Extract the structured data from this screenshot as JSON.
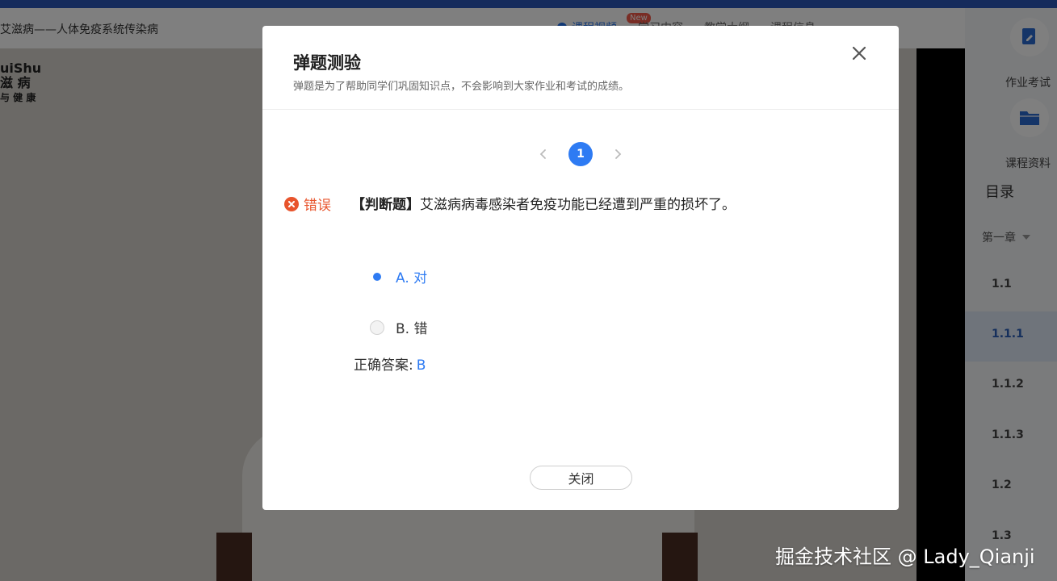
{
  "header": {
    "course_title": "艾滋病——人体免疫系统传染病",
    "tabs": [
      {
        "label": "课程视频",
        "active": true
      },
      {
        "label": "学习内容",
        "active": false
      },
      {
        "label": "教学大纲",
        "active": false
      },
      {
        "label": "课程信息",
        "active": false
      }
    ],
    "new_badge": "New"
  },
  "sidebar": {
    "tools": [
      {
        "label": "作业考试",
        "icon": "edit-document-icon"
      },
      {
        "label": "课程资料",
        "icon": "folder-icon"
      }
    ],
    "toc_title": "目录",
    "chapter": "第一章",
    "items": [
      {
        "label": "1.1",
        "active": false
      },
      {
        "label": "1.1.1",
        "active": true
      },
      {
        "label": "1.1.2",
        "active": false
      },
      {
        "label": "1.1.3",
        "active": false
      },
      {
        "label": "1.2",
        "active": false
      },
      {
        "label": "1.3",
        "active": false
      }
    ]
  },
  "video": {
    "logo_lines": [
      "uiShu",
      "滋 病",
      "与 健 康"
    ]
  },
  "modal": {
    "title": "弹题测验",
    "subtitle": "弹题是为了帮助同学们巩固知识点，不会影响到大家作业和考试的成绩。",
    "pager": {
      "current_page": "1"
    },
    "status_text": "错误",
    "question_type": "【判断题】",
    "question_text": "艾滋病病毒感染者免疫功能已经遭到严重的损坏了。",
    "options": [
      {
        "label": "A.  对",
        "selected": true
      },
      {
        "label": "B.  错",
        "selected": false
      }
    ],
    "answer_label": "正确答案:",
    "answer_value": "B",
    "close_button": "关闭"
  },
  "watermark": "掘金技术社区 @ Lady_Qianji",
  "colors": {
    "primary": "#2e7bf3",
    "error": "#e8542c",
    "top_strip": "#2b57b8"
  }
}
